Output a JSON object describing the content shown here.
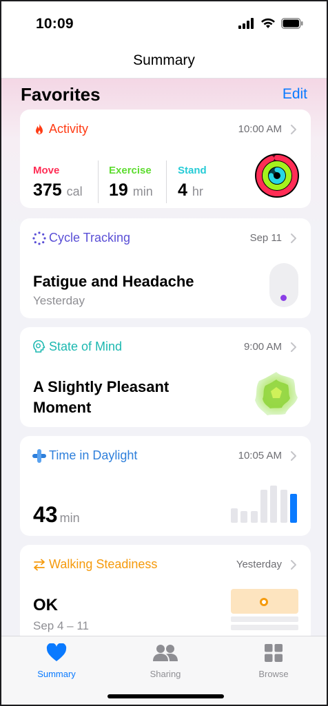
{
  "status_bar": {
    "time": "10:09"
  },
  "nav": {
    "title": "Summary"
  },
  "favorites": {
    "title": "Favorites",
    "edit_label": "Edit"
  },
  "activity": {
    "title": "Activity",
    "time": "10:00 AM",
    "accent": "#ff3b14",
    "move": {
      "label": "Move",
      "value": "375",
      "unit": "cal",
      "color": "#ff2d55"
    },
    "exercise": {
      "label": "Exercise",
      "value": "19",
      "unit": "min",
      "color": "#5ddc2f"
    },
    "stand": {
      "label": "Stand",
      "value": "4",
      "unit": "hr",
      "color": "#26cbd6"
    }
  },
  "cycle": {
    "title": "Cycle Tracking",
    "date": "Sep 11",
    "headline": "Fatigue and Headache",
    "subline": "Yesterday",
    "accent": "#5a4fd6"
  },
  "state_of_mind": {
    "title": "State of Mind",
    "time": "9:00 AM",
    "headline_line1": "A Slightly Pleasant",
    "headline_line2": "Moment",
    "accent": "#1cb8b0"
  },
  "daylight": {
    "title": "Time in Daylight",
    "time": "10:05 AM",
    "value": "43",
    "unit": "min",
    "accent": "#2e7fdb",
    "bars": [
      0.32,
      0.26,
      0.26,
      0.72,
      0.82,
      0.72,
      0.64
    ]
  },
  "walking": {
    "title": "Walking Steadiness",
    "date": "Yesterday",
    "headline": "OK",
    "subline": "Sep 4 – 11",
    "accent": "#f59a0c"
  },
  "tabs": [
    {
      "label": "Summary",
      "icon": "heart-icon",
      "active": true
    },
    {
      "label": "Sharing",
      "icon": "people-icon",
      "active": false
    },
    {
      "label": "Browse",
      "icon": "grid-icon",
      "active": false
    }
  ]
}
